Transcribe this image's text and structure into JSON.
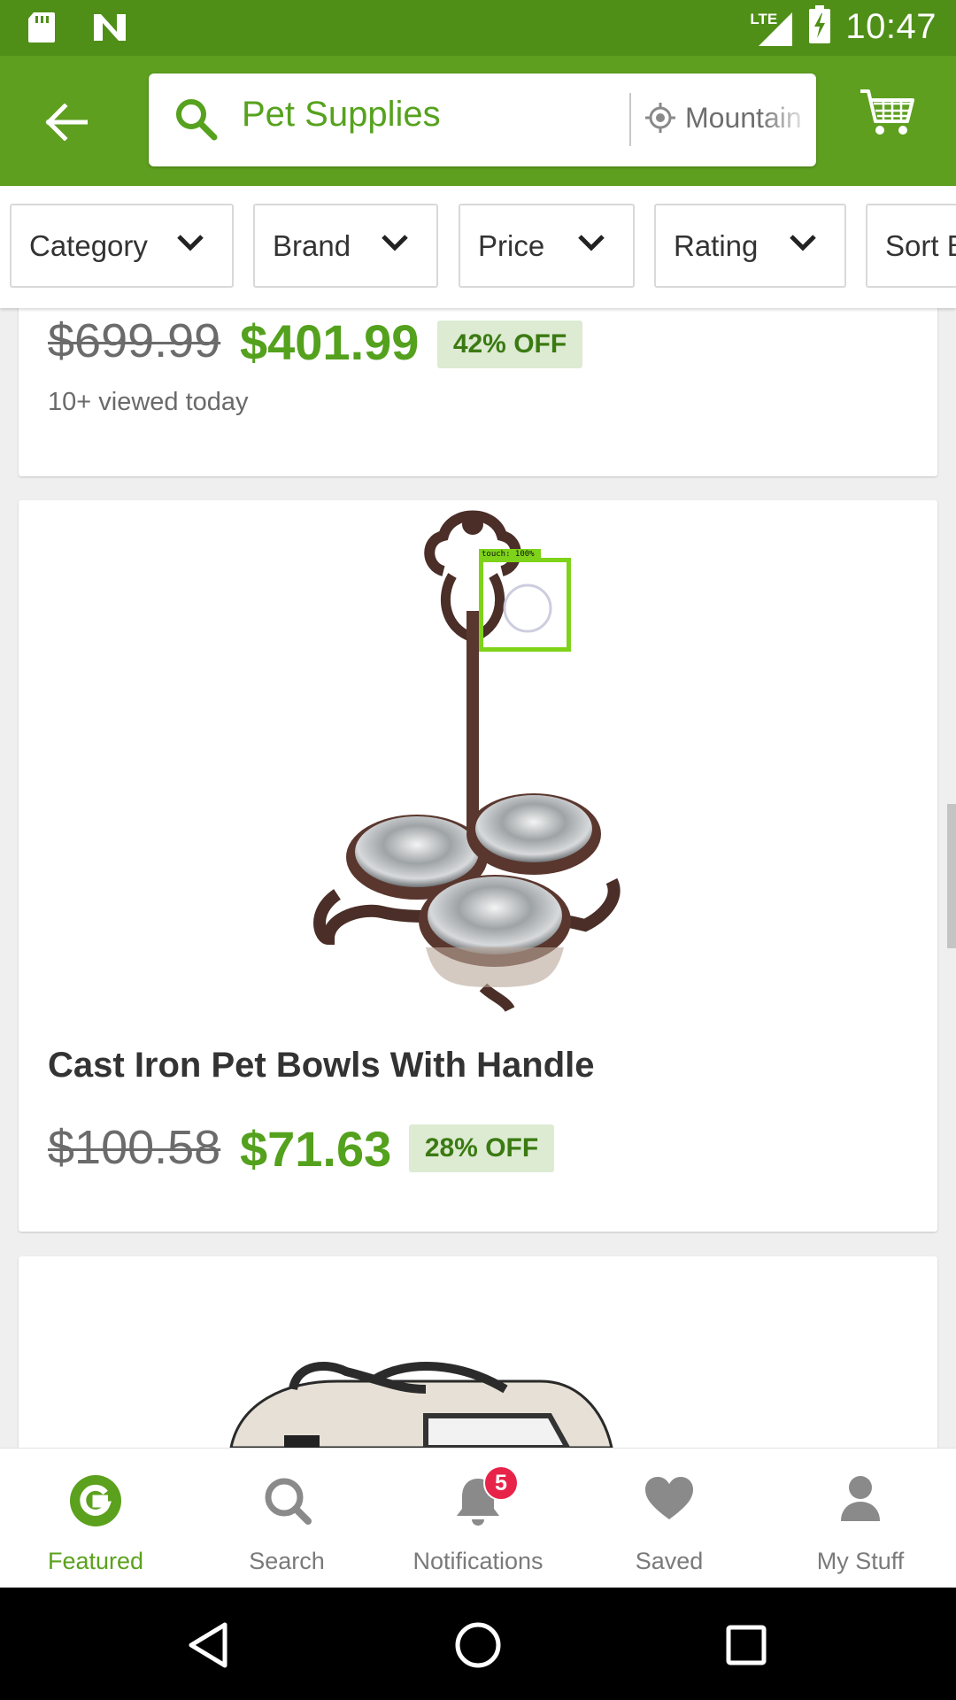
{
  "status_bar": {
    "network": "LTE",
    "time": "10:47"
  },
  "app_bar": {
    "search_query": "Pet Supplies",
    "location": "Mountain"
  },
  "filters": [
    {
      "label": "Category"
    },
    {
      "label": "Brand"
    },
    {
      "label": "Price"
    },
    {
      "label": "Rating"
    },
    {
      "label": "Sort By"
    }
  ],
  "products": [
    {
      "old_price": "$699.99",
      "new_price": "$401.99",
      "discount": "42% OFF",
      "views": "10+ viewed today"
    },
    {
      "title": "Cast Iron Pet Bowls With Handle",
      "old_price": "$100.58",
      "new_price": "$71.63",
      "discount": "28% OFF"
    }
  ],
  "overlay": {
    "touch_label": "touch: 100%"
  },
  "bottom_nav": {
    "items": [
      {
        "label": "Featured",
        "icon": "groupon-g-icon",
        "active": true
      },
      {
        "label": "Search",
        "icon": "search-icon"
      },
      {
        "label": "Notifications",
        "icon": "bell-icon"
      },
      {
        "label": "Saved",
        "icon": "heart-icon"
      },
      {
        "label": "My Stuff",
        "icon": "person-icon"
      }
    ],
    "notification_count": "5"
  },
  "colors": {
    "brand_green": "#5e9f1f",
    "status_bar": "#4f8f18",
    "price_green": "#53a11d",
    "badge_red": "#e8234a"
  }
}
